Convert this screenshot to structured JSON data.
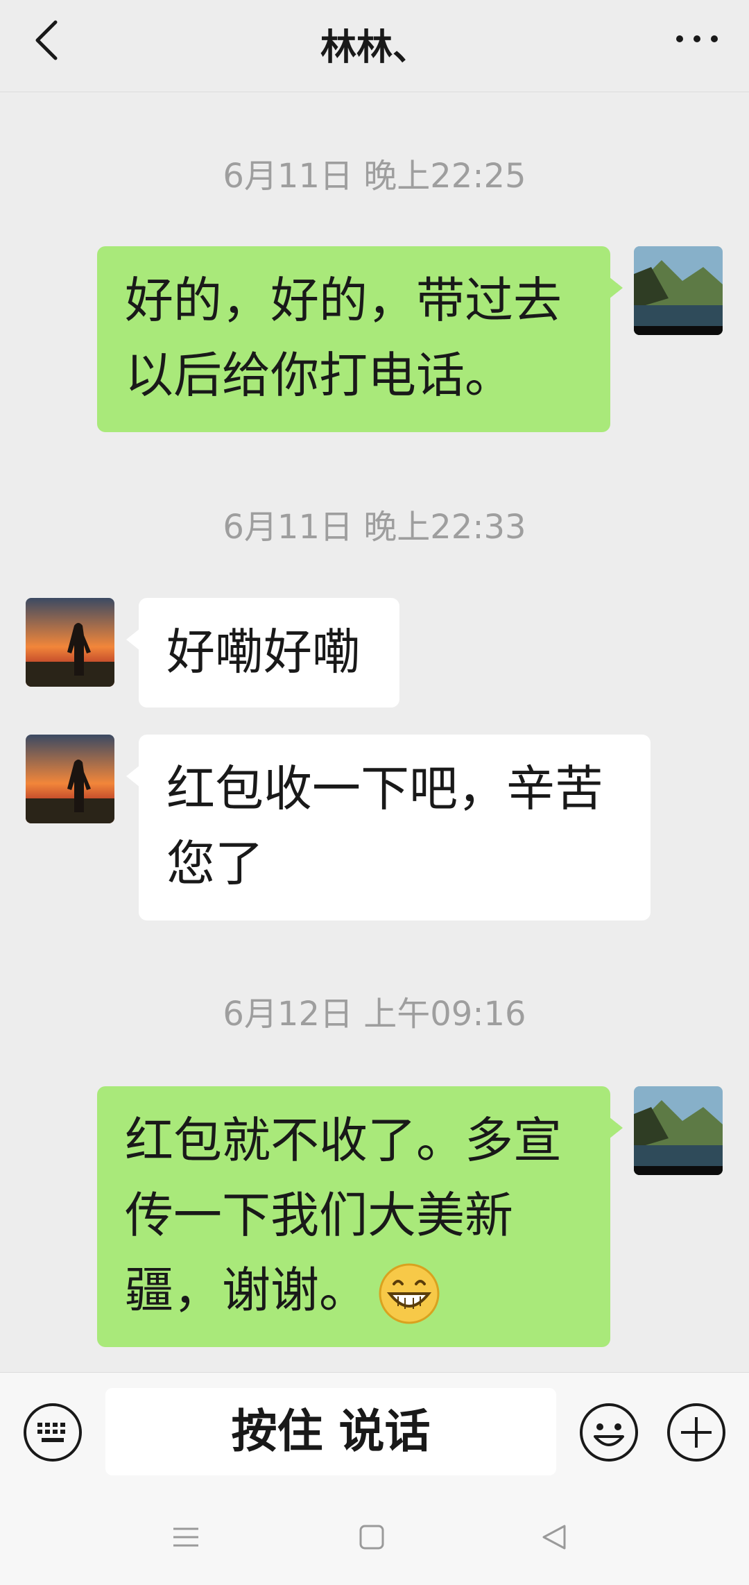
{
  "header": {
    "title": "林林、",
    "back_icon": "chevron-left-icon",
    "more_icon": "more-dots-icon"
  },
  "messages": [
    {
      "type": "timestamp",
      "text": "6月11日 晚上22:25"
    },
    {
      "type": "sent",
      "text": "好的，好的，带过去以后给你打电话。"
    },
    {
      "type": "timestamp",
      "text": "6月11日 晚上22:33"
    },
    {
      "type": "received",
      "text": "好嘞好嘞"
    },
    {
      "type": "received",
      "text": "红包收一下吧，辛苦您了"
    },
    {
      "type": "timestamp",
      "text": "6月12日 上午09:16"
    },
    {
      "type": "sent",
      "text": "红包就不收了。多宣传一下我们大美新疆，谢谢。",
      "emoji": "grin-emoji"
    }
  ],
  "input_bar": {
    "hold_to_talk_label": "按住 说话",
    "keyboard_icon": "keyboard-icon",
    "emoji_icon": "smiley-icon",
    "plus_icon": "plus-icon"
  },
  "nav_bar": {
    "icons": [
      "menu-icon",
      "home-square-icon",
      "back-triangle-icon"
    ]
  },
  "colors": {
    "background": "#ededed",
    "sent_bubble": "#a9e97a",
    "received_bubble": "#ffffff",
    "timestamp_text": "#9e9e9e"
  }
}
